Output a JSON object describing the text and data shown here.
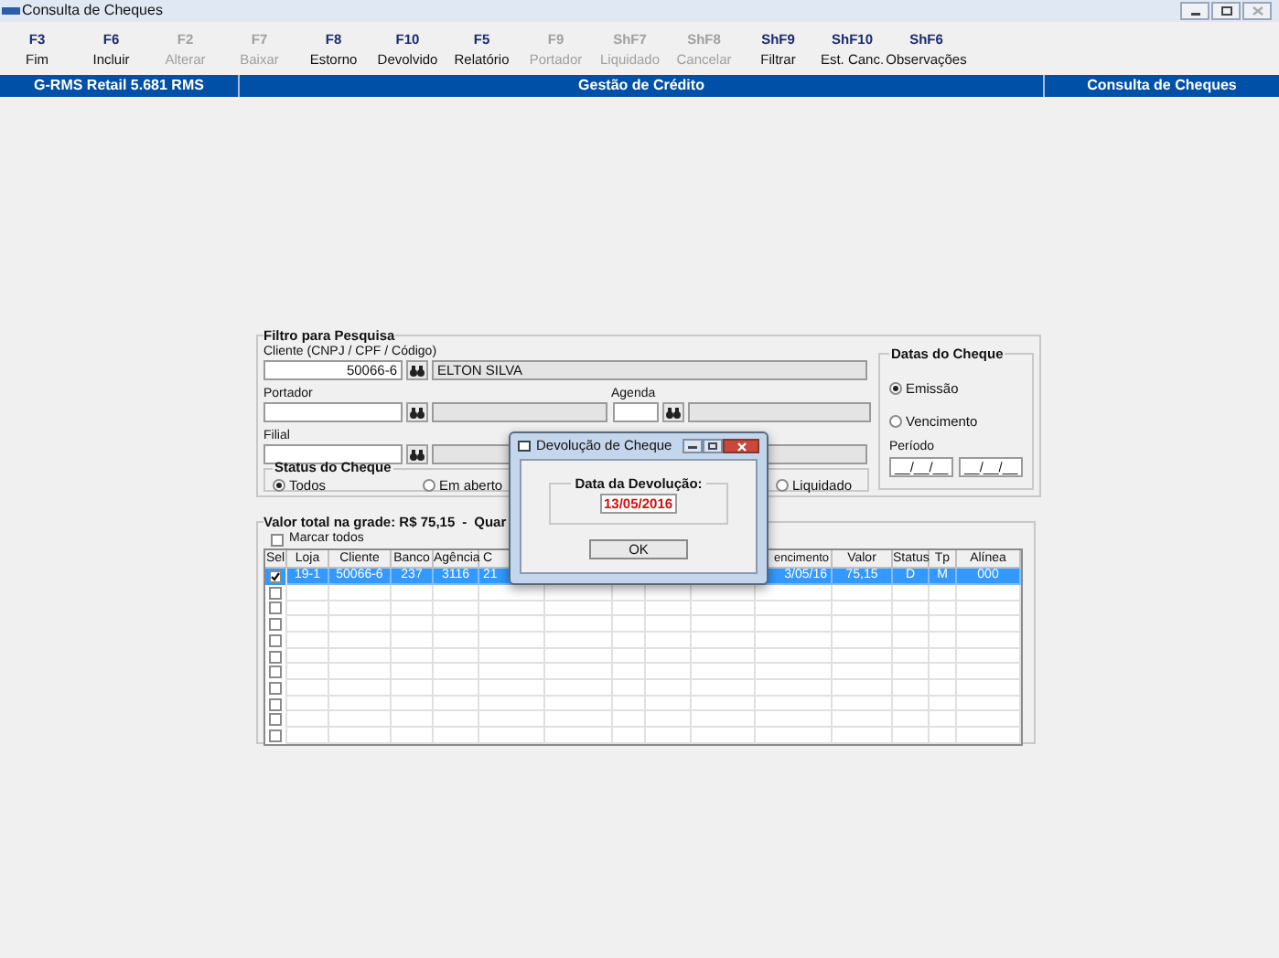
{
  "window": {
    "title": "Consulta de Cheques"
  },
  "toolbar": [
    {
      "key": "F3",
      "label": "Fim",
      "disabled": false
    },
    {
      "key": "F6",
      "label": "Incluir",
      "disabled": false
    },
    {
      "key": "F2",
      "label": "Alterar",
      "disabled": true
    },
    {
      "key": "F7",
      "label": "Baixar",
      "disabled": true
    },
    {
      "key": "F8",
      "label": "Estorno",
      "disabled": false
    },
    {
      "key": "F10",
      "label": "Devolvido",
      "disabled": false
    },
    {
      "key": "F5",
      "label": "Relatório",
      "disabled": false
    },
    {
      "key": "F9",
      "label": "Portador",
      "disabled": true
    },
    {
      "key": "ShF7",
      "label": "Liquidado",
      "disabled": true
    },
    {
      "key": "ShF8",
      "label": "Cancelar",
      "disabled": true
    },
    {
      "key": "ShF9",
      "label": "Filtrar",
      "disabled": false
    },
    {
      "key": "ShF10",
      "label": "Est. Canc.",
      "disabled": false
    },
    {
      "key": "ShF6",
      "label": "Observações",
      "disabled": false
    }
  ],
  "header_bar": {
    "app": "G-RMS Retail 5.681 RMS",
    "module": "Gestão de Crédito",
    "screen": "Consulta de Cheques"
  },
  "filter": {
    "title": "Filtro para Pesquisa",
    "cliente_label": "Cliente (CNPJ / CPF / Código)",
    "cliente_code": "50066-6",
    "cliente_name": "ELTON SILVA",
    "portador_label": "Portador",
    "agenda_label": "Agenda",
    "filial_label": "Filial",
    "status": {
      "title": "Status do Cheque",
      "options": [
        {
          "label": "Todos",
          "selected": true
        },
        {
          "label": "Em aberto",
          "selected": false
        },
        {
          "label": "Liquidado",
          "selected": false
        }
      ]
    }
  },
  "datas": {
    "title": "Datas do Cheque",
    "options": [
      {
        "label": "Emissão",
        "selected": true
      },
      {
        "label": "Vencimento",
        "selected": false
      }
    ],
    "periodo_label": "Período",
    "periodo_from": "__/__/__",
    "periodo_to": "__/__/__"
  },
  "grid": {
    "title": "Valor total na grade: R$ 75,15",
    "separator": "-",
    "title_cut": "Quar",
    "select_all": {
      "label": "Marcar todos",
      "checked": false
    },
    "columns": [
      {
        "label": "Sel"
      },
      {
        "label": "Loja"
      },
      {
        "label": "Cliente"
      },
      {
        "label": "Banco"
      },
      {
        "label": "Agência"
      },
      {
        "label": "C"
      },
      {},
      {},
      {},
      {},
      {
        "label": "encimento"
      },
      {
        "label": "Valor"
      },
      {
        "label": "Status"
      },
      {
        "label": "Tp"
      },
      {
        "label": "Alínea"
      }
    ],
    "rows": [
      {
        "checked": true,
        "selected": true,
        "cells": [
          "19-1",
          "50066-6",
          "237",
          "3116",
          "21",
          null,
          null,
          null,
          null,
          "3/05/16",
          "75,15",
          "D",
          "M",
          "000"
        ]
      },
      {
        "checked": false,
        "selected": false
      },
      {
        "checked": false,
        "selected": false
      },
      {
        "checked": false,
        "selected": false
      },
      {
        "checked": false,
        "selected": false
      },
      {
        "checked": false,
        "selected": false
      },
      {
        "checked": false,
        "selected": false
      },
      {
        "checked": false,
        "selected": false
      },
      {
        "checked": false,
        "selected": false
      },
      {
        "checked": false,
        "selected": false
      },
      {
        "checked": false,
        "selected": false
      }
    ]
  },
  "dialog": {
    "title": "Devolução de Cheque",
    "group": "Data da Devolução:",
    "date": "13/05/2016",
    "ok": "OK"
  }
}
